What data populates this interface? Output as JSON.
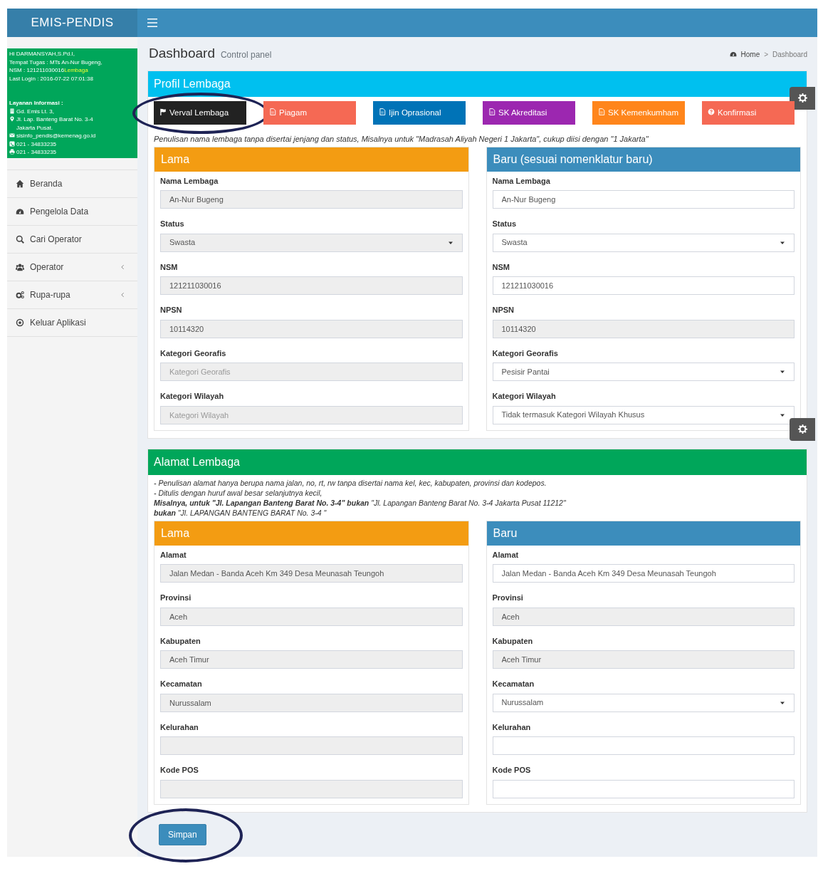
{
  "brand": "EMIS-PENDIS",
  "user_panel": {
    "greeting": "Hi DARMANSYAH,S.Pd.I,",
    "workplace": "Tempat Tugas : MTs An-Nur Bugeng,",
    "nsm": "NSM : 121211030016",
    "nsm_link": "Lembaga",
    "last_login": "Last Login : 2016-07-22 07:01:38",
    "info_title": "Layanan Informasi :",
    "info": [
      {
        "kind": "building",
        "text": "Gd. Emis Lt. 3,"
      },
      {
        "kind": "pin",
        "text": "Jl. Lap. Banteng Barat No. 3-4 Jakarta Pusat."
      },
      {
        "kind": "mail",
        "text": "sisinfo_pendis@kemenag.go.id"
      },
      {
        "kind": "phone",
        "text": "021 - 34833235"
      },
      {
        "kind": "printer",
        "text": "021 - 34833235"
      }
    ]
  },
  "sidebar": {
    "items": [
      {
        "kind": "home",
        "label": "Beranda",
        "submenu": false
      },
      {
        "kind": "gauge",
        "label": "Pengelola Data",
        "submenu": false
      },
      {
        "kind": "search",
        "label": "Cari Operator",
        "submenu": false
      },
      {
        "kind": "users",
        "label": "Operator",
        "submenu": true
      },
      {
        "kind": "gears",
        "label": "Rupa-rupa",
        "submenu": true
      },
      {
        "kind": "power",
        "label": "Keluar Aplikasi",
        "submenu": false
      }
    ]
  },
  "page_header": {
    "title": "Dashboard",
    "subtitle": "Control panel",
    "breadcrumb": [
      "Home",
      "Dashboard"
    ],
    "breadcrumb_separator": ">"
  },
  "profil": {
    "title": "Profil Lembaga",
    "tabs": [
      {
        "kind": "flag",
        "label": "Verval Lembaga",
        "color": "#222222",
        "circled": true
      },
      {
        "kind": "document",
        "label": "Piagam",
        "color": "#f56954",
        "circled": false
      },
      {
        "kind": "document",
        "label": "Ijin Oprasional",
        "color": "#0073b7",
        "circled": false
      },
      {
        "kind": "document",
        "label": "SK Akreditasi",
        "color": "#9c27b0",
        "circled": false
      },
      {
        "kind": "document",
        "label": "SK Kemenkumham",
        "color": "#ff851b",
        "circled": false
      },
      {
        "kind": "help",
        "label": "Konfirmasi",
        "color": "#f56954",
        "circled": false
      }
    ],
    "hint": "Penulisan nama lembaga tanpa disertai jenjang dan status, Misalnya untuk \"Madrasah Aliyah Negeri 1 Jakarta\", cukup diisi dengan \"1 Jakarta\"",
    "lama": {
      "title": "Lama",
      "fields": [
        {
          "label": "Nama Lembaga",
          "kind": "input",
          "value": "An-Nur Bugeng",
          "disabled": true
        },
        {
          "label": "Status",
          "kind": "select",
          "value": "Swasta",
          "disabled": true
        },
        {
          "label": "NSM",
          "kind": "input",
          "value": "121211030016",
          "disabled": true
        },
        {
          "label": "NPSN",
          "kind": "input",
          "value": "10114320",
          "disabled": true
        },
        {
          "label": "Kategori Georafis",
          "kind": "input",
          "placeholder": "Kategori Georafis",
          "disabled": true
        },
        {
          "label": "Kategori Wilayah",
          "kind": "input",
          "placeholder": "Kategori Wilayah",
          "disabled": true
        }
      ]
    },
    "baru": {
      "title": "Baru (sesuai nomenklatur baru)",
      "fields": [
        {
          "label": "Nama Lembaga",
          "kind": "input",
          "value": "An-Nur Bugeng",
          "disabled": false
        },
        {
          "label": "Status",
          "kind": "select",
          "value": "Swasta",
          "disabled": false
        },
        {
          "label": "NSM",
          "kind": "input",
          "value": "121211030016",
          "disabled": false
        },
        {
          "label": "NPSN",
          "kind": "input",
          "value": "10114320",
          "disabled": true
        },
        {
          "label": "Kategori Georafis",
          "kind": "select",
          "value": "Pesisir Pantai",
          "disabled": false
        },
        {
          "label": "Kategori Wilayah",
          "kind": "select",
          "value": "Tidak termasuk Kategori Wilayah Khusus",
          "disabled": false
        }
      ]
    }
  },
  "alamat": {
    "title": "Alamat Lembaga",
    "notes": [
      "- Penulisan alamat hanya berupa nama jalan, no, rt, rw tanpa disertai nama kel, kec, kabupaten, provinsi dan kodepos.",
      "- Ditulis dengan huruf awal besar selanjutnya kecil,",
      "**Misalnya, untuk \"Jl. Lapangan Banteng Barat No. 3-4\" bukan** \"Jl. Lapangan Banteng Barat No. 3-4 Jakarta Pusat 11212\"",
      "**bukan** \"Jl. LAPANGAN BANTENG BARAT No. 3-4 \""
    ],
    "lama": {
      "title": "Lama",
      "fields": [
        {
          "label": "Alamat",
          "kind": "input",
          "value": "Jalan Medan - Banda Aceh Km 349 Desa Meunasah Teungoh",
          "disabled": true
        },
        {
          "label": "Provinsi",
          "kind": "input",
          "value": "Aceh",
          "disabled": true
        },
        {
          "label": "Kabupaten",
          "kind": "input",
          "value": "Aceh Timur",
          "disabled": true
        },
        {
          "label": "Kecamatan",
          "kind": "input",
          "value": "Nurussalam",
          "disabled": true
        },
        {
          "label": "Kelurahan",
          "kind": "input",
          "disabled": true
        },
        {
          "label": "Kode POS",
          "kind": "input",
          "disabled": true
        }
      ]
    },
    "baru": {
      "title": "Baru",
      "fields": [
        {
          "label": "Alamat",
          "kind": "input",
          "value": "Jalan Medan - Banda Aceh Km 349 Desa Meunasah Teungoh",
          "disabled": false
        },
        {
          "label": "Provinsi",
          "kind": "input",
          "value": "Aceh",
          "disabled": true
        },
        {
          "label": "Kabupaten",
          "kind": "input",
          "value": "Aceh Timur",
          "disabled": true
        },
        {
          "label": "Kecamatan",
          "kind": "select",
          "value": "Nurussalam",
          "disabled": false
        },
        {
          "label": "Kelurahan",
          "kind": "input",
          "disabled": false
        },
        {
          "label": "Kode POS",
          "kind": "input",
          "disabled": false
        }
      ]
    }
  },
  "save_button": "Simpan"
}
